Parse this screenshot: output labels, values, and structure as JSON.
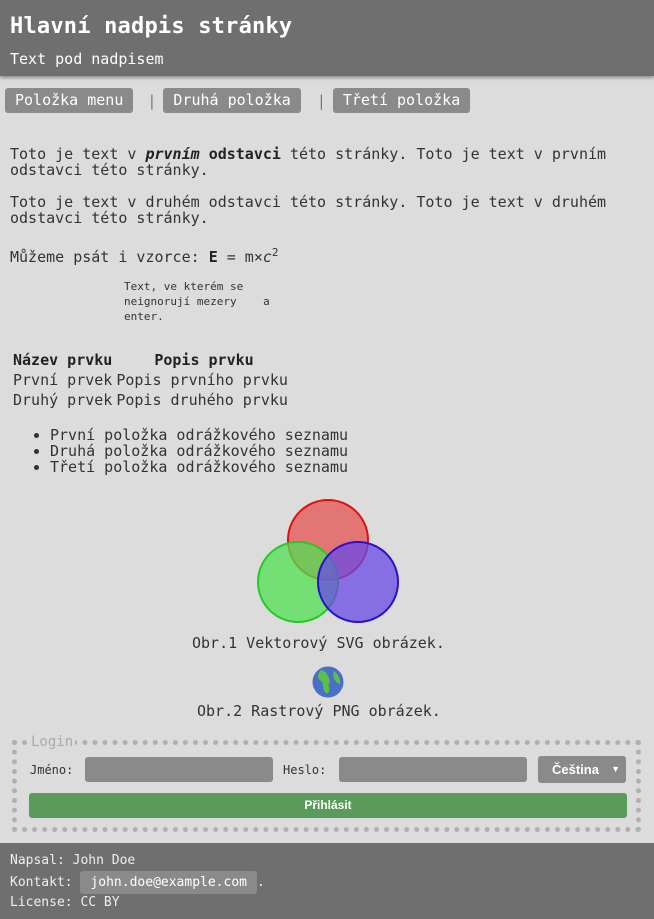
{
  "header": {
    "title": "Hlavní nadpis stránky",
    "subtitle": "Text pod nadpisem"
  },
  "nav": {
    "items": [
      "Položka menu",
      "Druhá položka",
      "Třetí položka"
    ],
    "separator": "|"
  },
  "paragraph1": {
    "prefix": "Toto je text v ",
    "emph_italic": "prvním",
    "emph_bold": "odstavci",
    "suffix": " této stránky. Toto je text v prvním odstavci této stránky."
  },
  "paragraph2": "Toto je text v druhém odstavci této stránky. Toto je text v druhém odstavci této stránky.",
  "formula": {
    "lead": "Můžeme psát i vzorce: ",
    "E": "E",
    "equals": " = m×",
    "c": "c",
    "exp": "2"
  },
  "preformatted": "Text, ve kterém se\nneignorují mezery    a\nenter.",
  "table": {
    "headers": [
      "Název prvku",
      "Popis prvku"
    ],
    "rows": [
      [
        "První prvek",
        "Popis prvního prvku"
      ],
      [
        "Druhý prvek",
        "Popis druhého prvku"
      ]
    ]
  },
  "bullets": [
    "První položka odrážkového seznamu",
    "Druhá položka odrážkového seznamu",
    "Třetí položka odrážkového seznamu"
  ],
  "figure1": {
    "caption": "Obr.1 Vektorový SVG obrázek.",
    "colors": [
      "#e55b5b",
      "#52e052",
      "#6a4ae6"
    ]
  },
  "figure2": {
    "caption": "Obr.2 Rastrový PNG obrázek.",
    "icon": "globe-icon"
  },
  "login": {
    "legend": "Login",
    "name_label": "Jméno:",
    "name_value": "",
    "password_label": "Heslo:",
    "password_value": "",
    "language": "Čeština",
    "submit": "Přihlásit"
  },
  "footer": {
    "author_label": "Napsal:",
    "author": "John Doe",
    "contact_label": "Kontakt:",
    "email": "john.doe@example.com",
    "email_suffix": ".",
    "license_label": "License:",
    "license": "CC BY"
  }
}
